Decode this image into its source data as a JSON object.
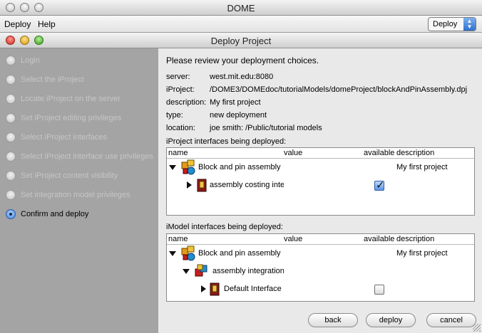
{
  "app": {
    "window_title": "DOME"
  },
  "menubar": {
    "items": [
      "Deploy",
      "Help"
    ],
    "deploy_select": "Deploy"
  },
  "dialog": {
    "title": "Deploy Project"
  },
  "steps": [
    {
      "label": "Login",
      "active": false
    },
    {
      "label": "Select the iProject",
      "active": false
    },
    {
      "label": "Locate iProject on the server",
      "active": false
    },
    {
      "label": "Set iProject editing privileges",
      "active": false
    },
    {
      "label": "Select iProject interfaces",
      "active": false
    },
    {
      "label": "Select iProject interface use privileges",
      "active": false
    },
    {
      "label": "Set iProject content visibility",
      "active": false
    },
    {
      "label": "Set integration model privileges",
      "active": false
    },
    {
      "label": "Confirm and deploy",
      "active": true
    }
  ],
  "review": {
    "heading": "Please review your deployment choices.",
    "fields": [
      {
        "key": "server:",
        "value": "west.mit.edu:8080"
      },
      {
        "key": "iProject:",
        "value": "/DOME3/DOMEdoc/tutorialModels/domeProject/blockAndPinAssembly.dpj"
      },
      {
        "key": "description:",
        "value": "My first project"
      },
      {
        "key": "type:",
        "value": "new deployment"
      },
      {
        "key": "location:",
        "value": "joe smith: /Public/tutorial models"
      }
    ]
  },
  "columns": {
    "name": "name",
    "value": "value",
    "available": "available",
    "description": "description"
  },
  "iproject_table": {
    "label": "iProject interfaces being deployed:",
    "rows": [
      {
        "name": "Block and pin assembly",
        "description": "My first project",
        "expanded": true,
        "available": null
      },
      {
        "name": "assembly costing inte",
        "description": "",
        "expanded": false,
        "available": true
      }
    ]
  },
  "imodel_table": {
    "label": "iModel interfaces being deployed:",
    "rows": [
      {
        "name": "Block and pin assembly",
        "description": "My first project",
        "expanded": true,
        "available": null
      },
      {
        "name": "assembly integration",
        "description": "",
        "expanded": true,
        "available": null
      },
      {
        "name": "Default Interface",
        "description": "",
        "expanded": false,
        "available": false
      }
    ]
  },
  "buttons": {
    "back": "back",
    "deploy": "deploy",
    "cancel": "cancel"
  },
  "colors": {
    "sidebar": "#a4a4a4",
    "content": "#e9e9e9",
    "accent": "#3d7fd8"
  }
}
